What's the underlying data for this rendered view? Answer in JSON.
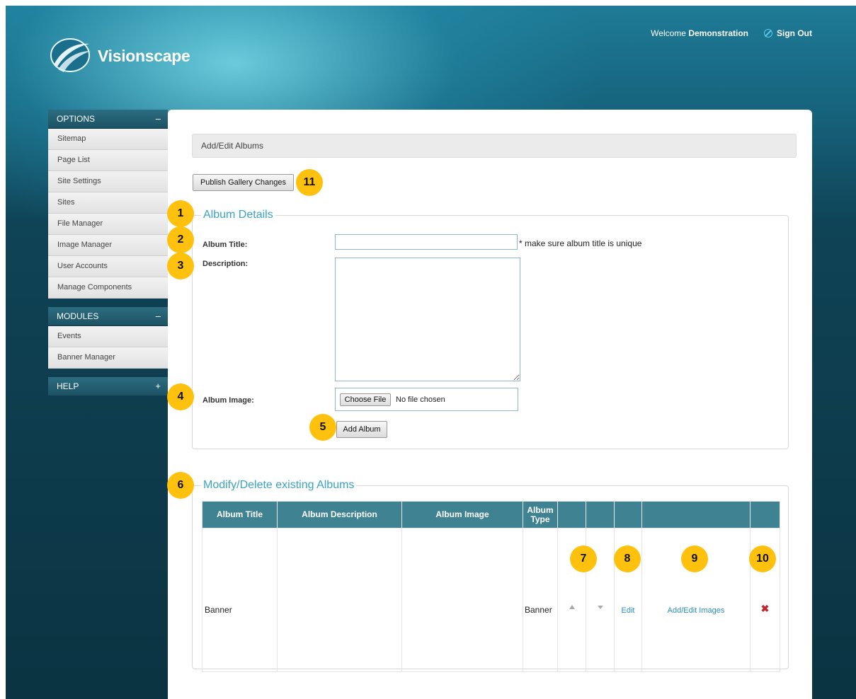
{
  "brand": {
    "name": "Visionscape"
  },
  "header": {
    "welcome_prefix": "Welcome",
    "user_name": "Demonstration",
    "sign_out": "Sign Out"
  },
  "sidebar": {
    "options": {
      "title": "OPTIONS",
      "toggle": "–",
      "items": [
        "Sitemap",
        "Page List",
        "Site Settings",
        "Sites",
        "File Manager",
        "Image Manager",
        "User Accounts",
        "Manage Components"
      ]
    },
    "modules": {
      "title": "MODULES",
      "toggle": "–",
      "items": [
        "Events",
        "Banner Manager"
      ]
    },
    "help": {
      "title": "HELP",
      "toggle": "+"
    }
  },
  "main": {
    "breadcrumb": "Add/Edit Albums",
    "publish_button": "Publish Gallery Changes",
    "details": {
      "legend": "Album Details",
      "title_label": "Album Title:",
      "title_value": "",
      "title_hint": "* make sure album title is unique",
      "description_label": "Description:",
      "description_value": "",
      "image_label": "Album Image:",
      "choose_file": "Choose File",
      "file_status": "No file chosen",
      "add_button": "Add Album"
    },
    "albums": {
      "legend": "Modify/Delete existing Albums",
      "columns": [
        "Album Title",
        "Album Description",
        "Album Image",
        "Album Type",
        "",
        "",
        "",
        ""
      ],
      "rows": [
        {
          "title": "Banner",
          "description": "",
          "image": "",
          "type": "Banner",
          "edit": "Edit",
          "images": "Add/Edit Images",
          "delete": "✖"
        }
      ]
    }
  },
  "callouts": [
    "1",
    "2",
    "3",
    "4",
    "5",
    "6",
    "7",
    "8",
    "9",
    "10",
    "11"
  ],
  "colors": {
    "accent": "#3aa3c4",
    "table_header": "#3f8393",
    "callout": "#fec10e",
    "delete": "#c0272d"
  }
}
